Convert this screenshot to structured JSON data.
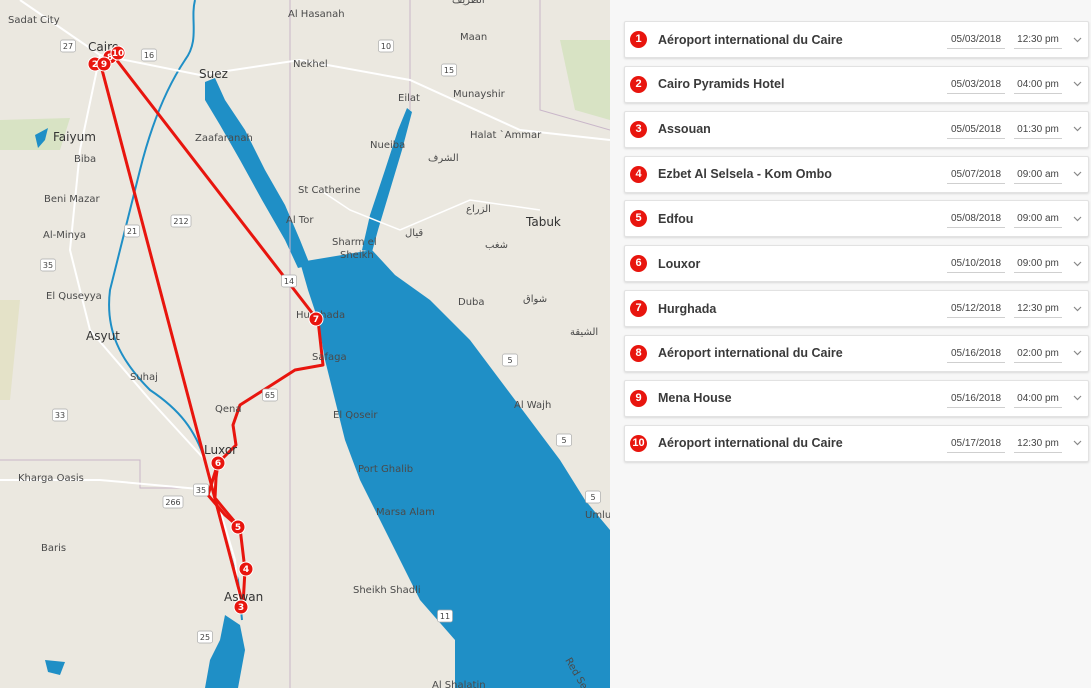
{
  "map": {
    "labels": {
      "sadat_city": "Sadat City",
      "al_hasanah": "Al Hasanah",
      "cairo": "Cairo",
      "maan": "Maan",
      "nekhel": "Nekhel",
      "suez": "Suez",
      "eilat": "Eilat",
      "munayshir": "Munayshir",
      "halat_ammar": "Halat `Ammar",
      "faiyum": "Faiyum",
      "zaafaranah": "Zaafaranah",
      "nueiba": "Nueiba",
      "biba": "Biba",
      "st_catherine": "St Catherine",
      "beni_mazar": "Beni Mazar",
      "al_tor": "Al Tor",
      "tabuk": "Tabuk",
      "al_minya": "Al-Minya",
      "sharm": "Sharm el",
      "sheikh": "Sheikh",
      "el_quseyya": "El Quseyya",
      "duba": "Duba",
      "asyut": "Asyut",
      "hurghada": "Hurghada",
      "safaga": "Safaga",
      "suhaj": "Suhaj",
      "al_wajh": "Al Wajh",
      "qena": "Qena",
      "el_qoseir": "El Qoseir",
      "luxor": "Luxor",
      "kharga": "Kharga Oasis",
      "port_ghalib": "Port Ghalib",
      "umluj": "Umluj",
      "marsa_alam": "Marsa Alam",
      "baris": "Baris",
      "aswan": "Aswan",
      "sheikh_shadli": "Sheikh Shadli",
      "red_sea": "Red Sea",
      "al_shalatin": "Al Shalatin",
      "ar_tarif": "الطريف",
      "ash_sharaf": "الشرف",
      "az_zara": "الزراع",
      "qiyal": "قيال",
      "shaghab": "شغب",
      "shawaq": "شواق",
      "al_ashushiyah": "الشيقة"
    },
    "shields": [
      "27",
      "16",
      "10",
      "15",
      "212",
      "21",
      "35",
      "33",
      "266",
      "35",
      "25",
      "11",
      "5",
      "5",
      "5",
      "65",
      "14"
    ],
    "markers": [
      "1",
      "2",
      "3",
      "4",
      "5",
      "6",
      "7",
      "8",
      "9",
      "10"
    ],
    "colors": {
      "route": "#e8150e",
      "water": "#1f8fc6",
      "land": "#ebe8e0",
      "marker": "#e8150e"
    }
  },
  "itinerary": {
    "stops": [
      {
        "num": "1",
        "name": "Aéroport international du Caire",
        "date": "05/03/2018",
        "time": "12:30 pm"
      },
      {
        "num": "2",
        "name": "Cairo Pyramids Hotel",
        "date": "05/03/2018",
        "time": "04:00 pm"
      },
      {
        "num": "3",
        "name": "Assouan",
        "date": "05/05/2018",
        "time": "01:30 pm"
      },
      {
        "num": "4",
        "name": "Ezbet Al Selsela - Kom Ombo",
        "date": "05/07/2018",
        "time": "09:00 am"
      },
      {
        "num": "5",
        "name": "Edfou",
        "date": "05/08/2018",
        "time": "09:00 am"
      },
      {
        "num": "6",
        "name": "Louxor",
        "date": "05/10/2018",
        "time": "09:00 pm"
      },
      {
        "num": "7",
        "name": "Hurghada",
        "date": "05/12/2018",
        "time": "12:30 pm"
      },
      {
        "num": "8",
        "name": "Aéroport international du Caire",
        "date": "05/16/2018",
        "time": "02:00 pm"
      },
      {
        "num": "9",
        "name": "Mena House",
        "date": "05/16/2018",
        "time": "04:00 pm"
      },
      {
        "num": "10",
        "name": "Aéroport international du Caire",
        "date": "05/17/2018",
        "time": "12:30 pm"
      }
    ]
  }
}
